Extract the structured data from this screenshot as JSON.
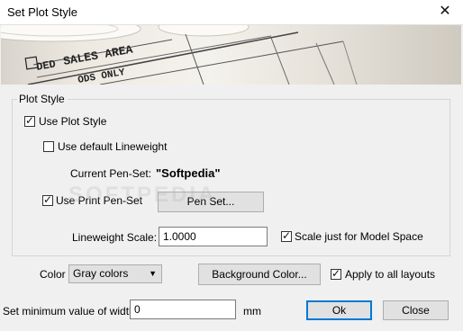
{
  "window": {
    "title": "Set Plot Style",
    "close_glyph": "✕"
  },
  "banner": {
    "texts": [
      "DED",
      "SALES AREA",
      "ODS ONLY"
    ]
  },
  "plot_style": {
    "legend": "Plot Style",
    "use_plot_style": {
      "label": "Use Plot Style",
      "checked": true
    },
    "use_default_lineweight": {
      "label": "Use default Lineweight",
      "checked": false
    },
    "current_pen_set_label": "Current Pen-Set:",
    "current_pen_set_value": "\"Softpedia\"",
    "use_print_pen_set": {
      "label": "Use Print Pen-Set",
      "checked": true
    },
    "pen_set_button": "Pen Set...",
    "lineweight_scale_label": "Lineweight Scale:",
    "lineweight_scale_value": "1.0000",
    "scale_model_space": {
      "label": "Scale just for Model Space",
      "checked": true
    }
  },
  "color": {
    "label": "Color",
    "selected": "Gray colors",
    "background_button": "Background Color...",
    "apply_all_layouts": {
      "label": "Apply to all layouts",
      "checked": true
    }
  },
  "width": {
    "label": "Set minimum value of width",
    "value": "0",
    "unit": "mm"
  },
  "footer": {
    "ok": "Ok",
    "close": "Close"
  },
  "watermark": "SOFTPEDIA",
  "check_glyph": "✓",
  "dropdown_glyph": "▼"
}
